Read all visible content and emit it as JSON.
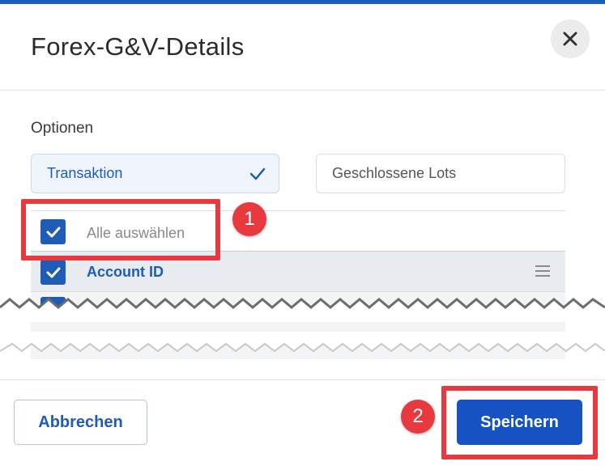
{
  "colors": {
    "accent": "#1f5cb8",
    "primary_button": "#1752c2",
    "annotation": "#e8393f",
    "header_row": "#e8ebf0"
  },
  "dialog": {
    "title": "Forex-G&V-Details",
    "close_icon": "close-x-icon"
  },
  "options": {
    "label": "Optionen",
    "items": [
      {
        "label": "Transaktion",
        "selected": true
      },
      {
        "label": "Geschlossene Lots",
        "selected": false
      }
    ]
  },
  "columns": {
    "select_all_label": "Alle auswählen",
    "select_all_checked": true,
    "rows": [
      {
        "label": "Account ID",
        "checked": true,
        "icon": "drag-handle-icon"
      }
    ]
  },
  "annotations": [
    {
      "number": "1",
      "target": "select-all"
    },
    {
      "number": "2",
      "target": "save-button"
    }
  ],
  "footer": {
    "cancel_label": "Abbrechen",
    "save_label": "Speichern"
  }
}
